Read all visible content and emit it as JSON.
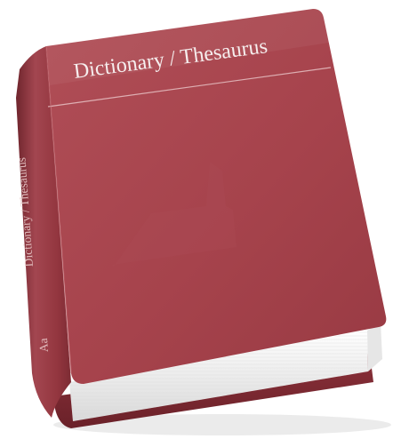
{
  "book": {
    "cover_title": "Dictionary / Thesaurus",
    "spine_title": "Dictionary / Thesaurus",
    "spine_mark": "Aa",
    "colors": {
      "cover": "#a8464f",
      "cover_dark": "#7e2c35",
      "spine": "#8e333c",
      "pages": "#f4f4f4",
      "title_text": "#f6eeee"
    }
  }
}
